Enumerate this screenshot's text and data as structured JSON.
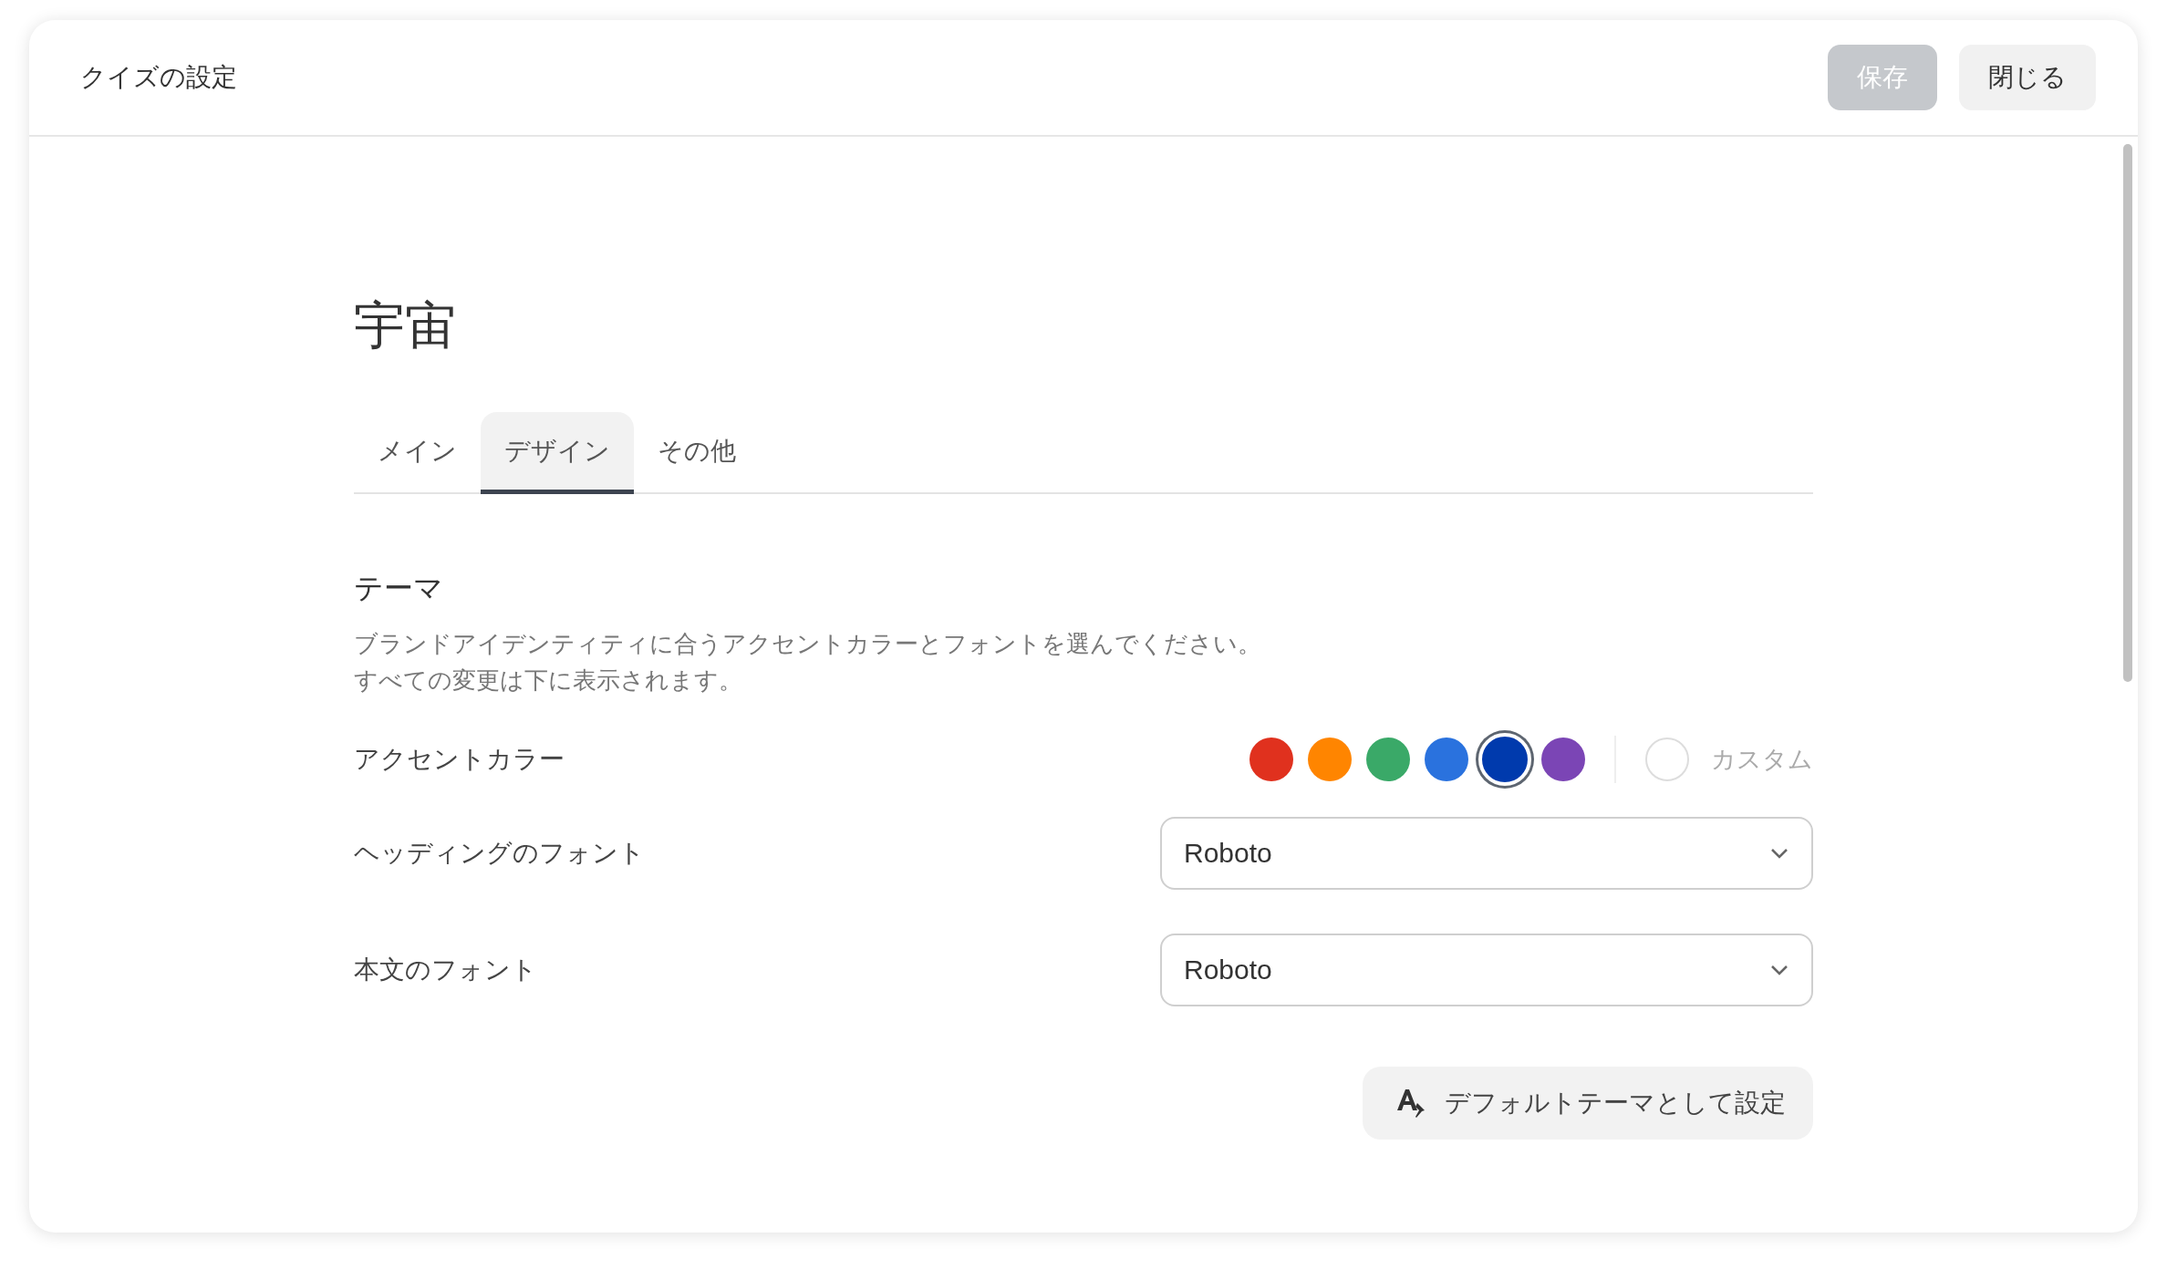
{
  "header": {
    "title": "クイズの設定",
    "buttons": [
      {
        "label": "保存",
        "disabled": true
      },
      {
        "label": "閉じる",
        "disabled": false
      }
    ]
  },
  "quiz_title": "宇宙",
  "tabs": [
    {
      "label": "メイン",
      "selected": false
    },
    {
      "label": "デザイン",
      "selected": true
    },
    {
      "label": "その他",
      "selected": false
    }
  ],
  "theme": {
    "title": "テーマ",
    "description": [
      "ブランドアイデンティティに合うアクセントカラーとフォントを選んでください。",
      "すべての変更は下に表示されます。"
    ],
    "accent": {
      "label": "アクセントカラー",
      "swatches": [
        {
          "color": "#e0311e",
          "selected": false
        },
        {
          "color": "#ff8500",
          "selected": false
        },
        {
          "color": "#3aa968",
          "selected": false
        },
        {
          "color": "#2a72de",
          "selected": false
        },
        {
          "color": "#003aad",
          "selected": true
        },
        {
          "color": "#7b45b5",
          "selected": false
        }
      ],
      "custom_label": "カスタム"
    },
    "fonts": [
      {
        "label": "ヘッディングのフォント",
        "value": "Roboto"
      },
      {
        "label": "本文のフォント",
        "value": "Roboto"
      }
    ],
    "default_button": "デフォルトテーマとして設定"
  }
}
